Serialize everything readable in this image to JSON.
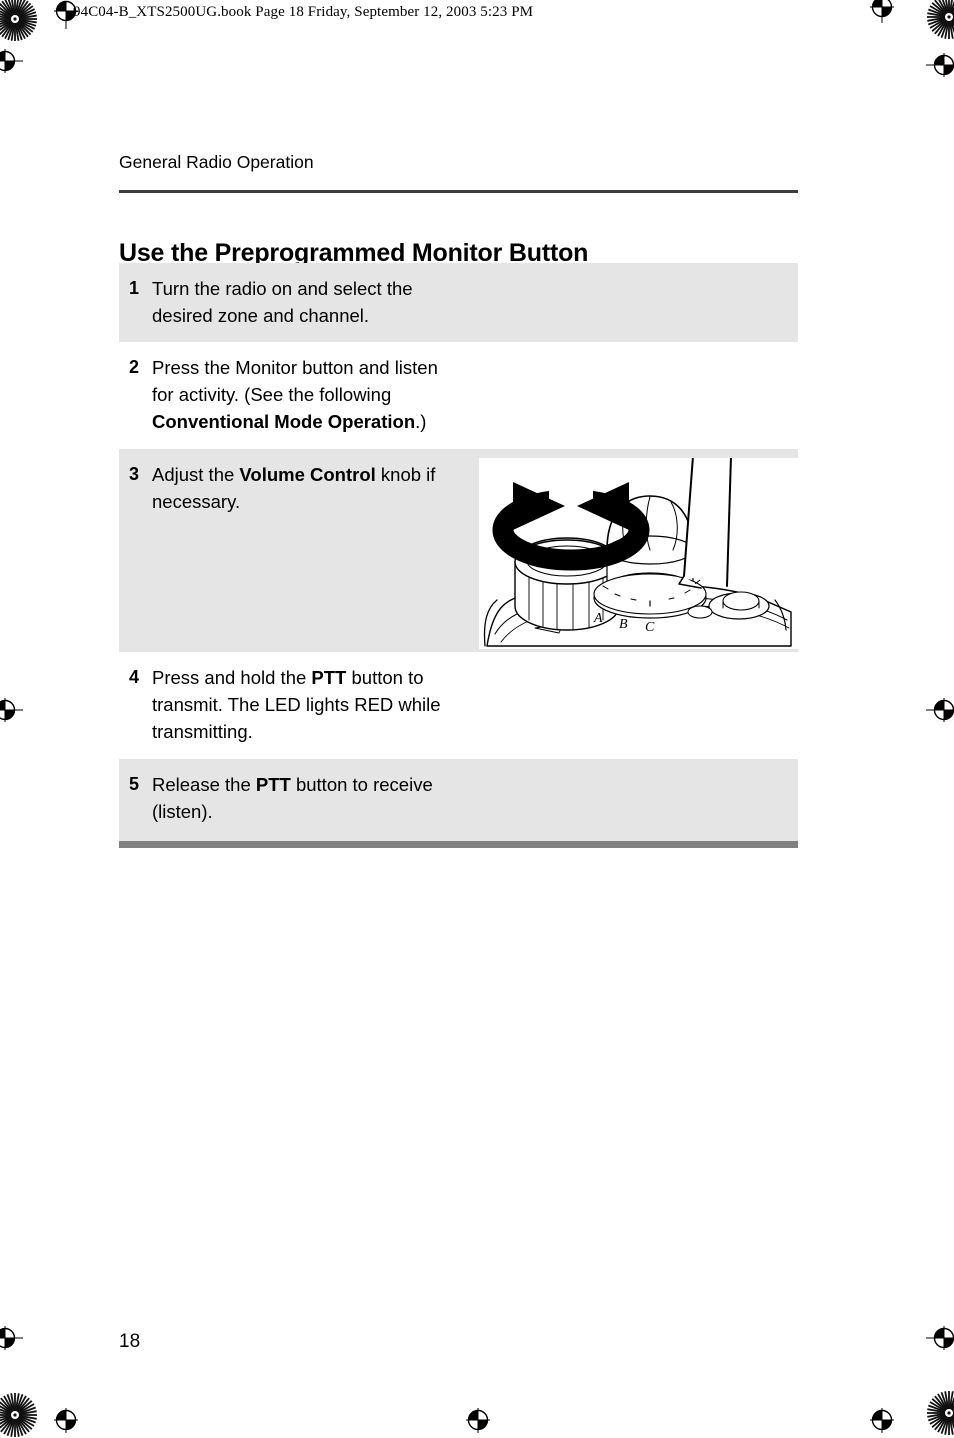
{
  "file_header": "94C04-B_XTS2500UG.book  Page 18  Friday, September 12, 2003  5:23 PM",
  "running_head": "General Radio Operation",
  "section_title": "Use the Preprogrammed Monitor Button",
  "page_number": "18",
  "colors": {
    "row_shade": "#e5e5e5",
    "head_rule": "#3b3b3b",
    "table_bottom_rule": "#808080",
    "text": "#000000"
  },
  "procedure": {
    "rows": [
      {
        "number": "1",
        "shaded": true,
        "segments": [
          {
            "text": "Turn the radio on and select the desired zone and channel.",
            "bold": false
          }
        ]
      },
      {
        "number": "2",
        "shaded": false,
        "segments": [
          {
            "text": "Press the Monitor button and listen for activity. (See the following ",
            "bold": false
          },
          {
            "text": "Conventional Mode Operation",
            "bold": true
          },
          {
            "text": ".)",
            "bold": false
          }
        ]
      },
      {
        "number": "3",
        "shaded": true,
        "segments": [
          {
            "text": "Adjust the ",
            "bold": false
          },
          {
            "text": "Volume Control",
            "bold": true
          },
          {
            "text": " knob if necessary.",
            "bold": false
          }
        ]
      },
      {
        "number": "4",
        "shaded": false,
        "segments": [
          {
            "text": "Press and hold the ",
            "bold": false
          },
          {
            "text": "PTT",
            "bold": true
          },
          {
            "text": " button to transmit. The LED lights RED while transmitting.",
            "bold": false
          }
        ]
      },
      {
        "number": "5",
        "shaded": true,
        "segments": [
          {
            "text": "Release the ",
            "bold": false
          },
          {
            "text": "PTT",
            "bold": true
          },
          {
            "text": " button to receive (listen).",
            "bold": false
          }
        ]
      }
    ]
  },
  "illustration": {
    "name": "radio-top-volume-knob-diagram",
    "description": "Line drawing of the top of a portable two-way radio showing the volume control knob with a bidirectional circular rotation arrow, the channel selector knob, and the antenna.",
    "switch_labels": [
      "A",
      "B",
      "C"
    ]
  }
}
